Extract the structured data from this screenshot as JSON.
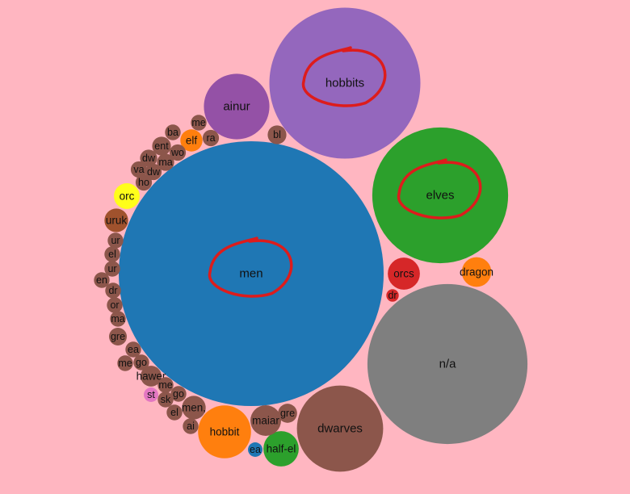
{
  "chart_data": {
    "type": "bubble",
    "background": "#ffb6c1",
    "label_color": "#111111",
    "annotation_color": "#dd1c1c",
    "annotated_labels": [
      "hobbits",
      "elves",
      "men"
    ],
    "bubbles": [
      {
        "label": "men",
        "value": 100,
        "color": "#1f77b4"
      },
      {
        "label": "n/a",
        "value": 36.5,
        "color": "#7f7f7f"
      },
      {
        "label": "hobbits",
        "value": 32.5,
        "color": "#9467bd"
      },
      {
        "label": "elves",
        "value": 26.3,
        "color": "#2ca02c"
      },
      {
        "label": "dwarves",
        "value": 10.6,
        "color": "#8c564b"
      },
      {
        "label": "ainur",
        "value": 6.12,
        "color": "#9451a6"
      },
      {
        "label": "hobbit",
        "value": 4.0,
        "color": "#ff7f0e"
      },
      {
        "label": "half-el",
        "value": 1.78,
        "color": "#2ca02c"
      },
      {
        "label": "orcs",
        "value": 1.47,
        "color": "#d62728"
      },
      {
        "label": "dragon",
        "value": 1.25,
        "color": "#ff7f0e"
      },
      {
        "label": "maiar",
        "value": 1.34,
        "color": "#8c564b"
      },
      {
        "label": "orc",
        "value": 0.95,
        "color": "#ffff1a"
      },
      {
        "label": "men,",
        "value": 0.8,
        "color": "#8c564b"
      },
      {
        "label": "uruk",
        "value": 0.8,
        "color": "#a0522d"
      },
      {
        "label": "elf",
        "value": 0.7,
        "color": "#ff7f0e"
      },
      {
        "label": "hawer",
        "value": 0.62,
        "color": "#8c564b"
      },
      {
        "label": "gre",
        "value": 0.52,
        "color": "#8c564b"
      },
      {
        "label": "ent",
        "value": 0.5,
        "color": "#8c564b"
      },
      {
        "label": "bl",
        "value": 0.5,
        "color": "#8c564b"
      },
      {
        "label": "dw",
        "value": 0.42,
        "color": "#8c564b"
      },
      {
        "label": "ma",
        "value": 0.42,
        "color": "#8c564b"
      },
      {
        "label": "gre",
        "value": 0.45,
        "color": "#8c564b"
      },
      {
        "label": "ra",
        "value": 0.38,
        "color": "#8c564b"
      },
      {
        "label": "wo",
        "value": 0.38,
        "color": "#8c564b"
      },
      {
        "label": "va",
        "value": 0.38,
        "color": "#8c564b"
      },
      {
        "label": "dw",
        "value": 0.38,
        "color": "#8c564b"
      },
      {
        "label": "ho",
        "value": 0.38,
        "color": "#8c564b"
      },
      {
        "label": "me",
        "value": 0.35,
        "color": "#8c564b"
      },
      {
        "label": "ba",
        "value": 0.35,
        "color": "#8c564b"
      },
      {
        "label": "ur",
        "value": 0.35,
        "color": "#8c564b"
      },
      {
        "label": "el",
        "value": 0.35,
        "color": "#8c564b"
      },
      {
        "label": "ur",
        "value": 0.35,
        "color": "#8c564b"
      },
      {
        "label": "en",
        "value": 0.35,
        "color": "#8c564b"
      },
      {
        "label": "dr",
        "value": 0.35,
        "color": "#8c564b"
      },
      {
        "label": "or",
        "value": 0.35,
        "color": "#8c564b"
      },
      {
        "label": "ma",
        "value": 0.35,
        "color": "#8c564b"
      },
      {
        "label": "ea",
        "value": 0.35,
        "color": "#8c564b"
      },
      {
        "label": "me",
        "value": 0.35,
        "color": "#8c564b"
      },
      {
        "label": "go",
        "value": 0.35,
        "color": "#8c564b"
      },
      {
        "label": "me",
        "value": 0.35,
        "color": "#8c564b"
      },
      {
        "label": "go",
        "value": 0.35,
        "color": "#8c564b"
      },
      {
        "label": "sk",
        "value": 0.35,
        "color": "#8c564b"
      },
      {
        "label": "el",
        "value": 0.35,
        "color": "#8c564b"
      },
      {
        "label": "ai",
        "value": 0.35,
        "color": "#8c564b"
      },
      {
        "label": "st",
        "value": 0.3,
        "color": "#e377c2"
      },
      {
        "label": "ea",
        "value": 0.3,
        "color": "#1f77b4"
      },
      {
        "label": "dr",
        "value": 0.22,
        "color": "#d62728"
      }
    ]
  }
}
